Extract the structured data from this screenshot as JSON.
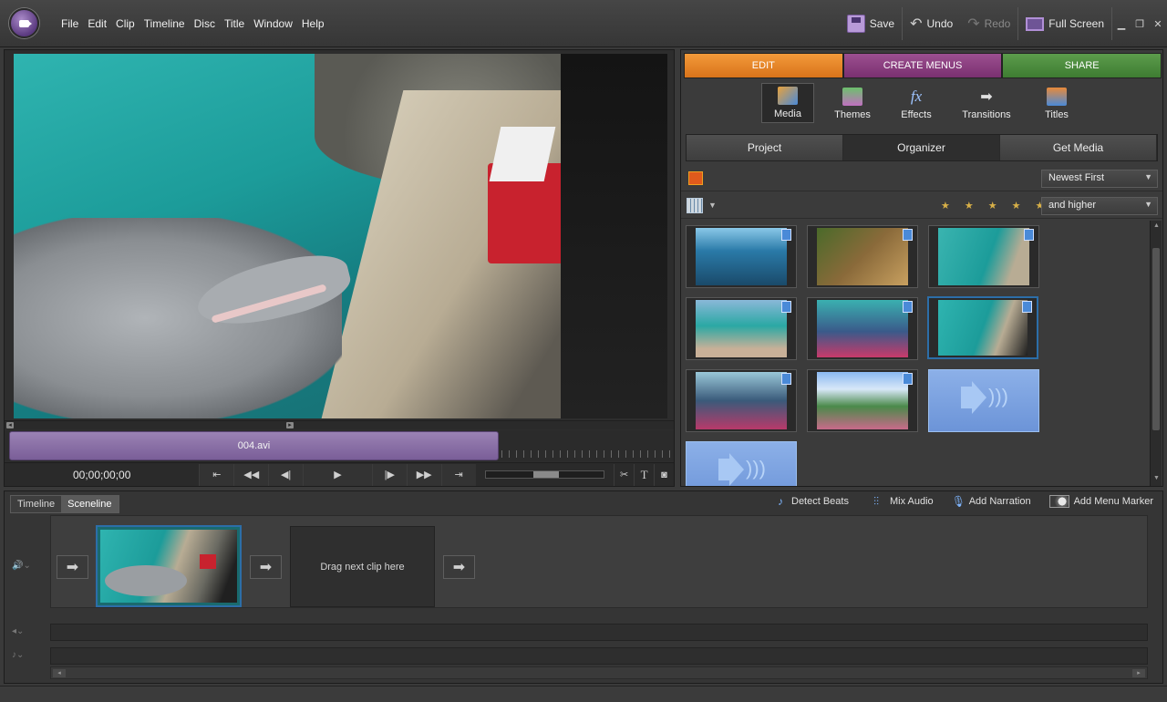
{
  "app": {
    "logo_icon": "premiere-elements-logo-icon"
  },
  "menu": [
    "File",
    "Edit",
    "Clip",
    "Timeline",
    "Disc",
    "Title",
    "Window",
    "Help"
  ],
  "toolbar": {
    "save_label": "Save",
    "undo_label": "Undo",
    "redo_label": "Redo",
    "fullscreen_label": "Full Screen"
  },
  "monitor": {
    "clip_name": "004.avi",
    "timecode": "00;00;00;00"
  },
  "workspace_tabs": [
    "EDIT",
    "CREATE MENUS",
    "SHARE"
  ],
  "task_buttons": [
    "Media",
    "Themes",
    "Effects",
    "Transitions",
    "Titles"
  ],
  "media_tabs": [
    "Project",
    "Organizer",
    "Get Media"
  ],
  "filters": {
    "sort": "Newest First",
    "rating": "and higher",
    "stars_count": 5
  },
  "timeline": {
    "tabs": [
      "Timeline",
      "Sceneline"
    ],
    "tools": {
      "detect_beats": "Detect Beats",
      "mix_audio": "Mix Audio",
      "add_narration": "Add Narration",
      "add_menu_marker": "Add Menu Marker"
    },
    "drop_zone": "Drag next clip here"
  },
  "colors": {
    "edit_tab": "#f29a3a",
    "create_menus_tab": "#9c4f90",
    "share_tab": "#5c9c4c",
    "selection": "#2c6ea8"
  }
}
